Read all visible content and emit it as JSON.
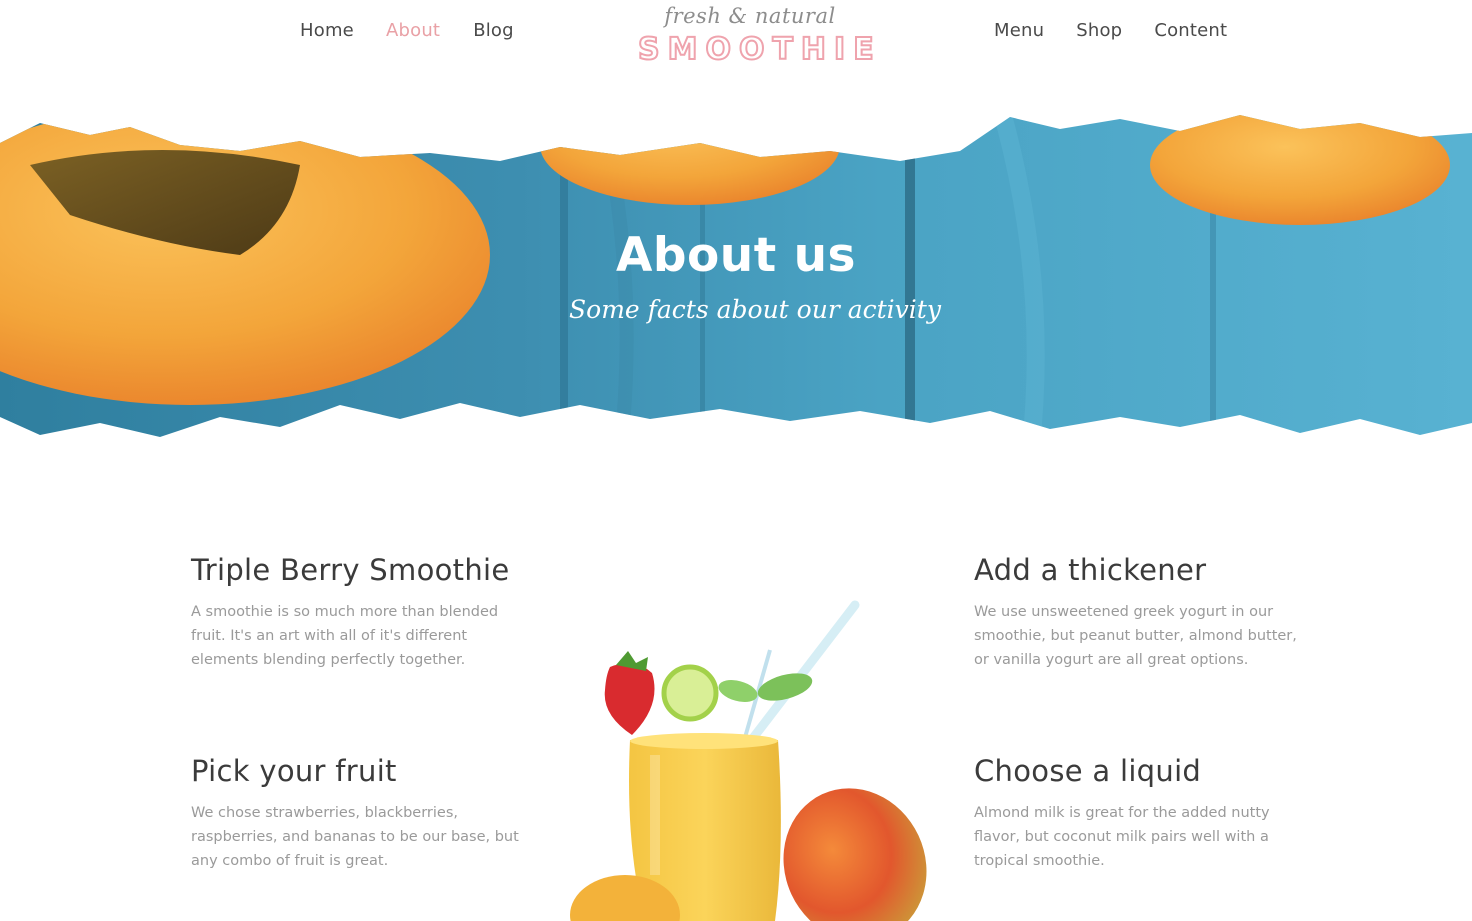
{
  "nav_left": [
    "Home",
    "About",
    "Blog"
  ],
  "nav_right": [
    "Menu",
    "Shop",
    "Content"
  ],
  "active_nav": "About",
  "logo": {
    "tagline": "fresh & natural",
    "brand": "SMOOTHIE"
  },
  "hero": {
    "title": "About us",
    "subtitle": "Some facts about our activity"
  },
  "features": [
    {
      "title": "Triple Berry Smoothie",
      "text": "A smoothie is so much more than blended fruit. It's an art with all of it's different elements blending perfectly together."
    },
    {
      "title": "Add a thickener",
      "text": "We use unsweetened greek yogurt in our smoothie, but peanut butter, almond butter, or vanilla yogurt are all great options."
    },
    {
      "title": "Pick your fruit",
      "text": "We chose strawberries, blackberries, raspberries, and bananas to be our base, but any combo of fruit is great."
    },
    {
      "title": "Choose a liquid",
      "text": "Almond milk is great for the added nutty flavor, but coconut milk pairs well with a tropical smoothie."
    }
  ],
  "colors": {
    "accent_pink": "#e9a1a6",
    "nav_text": "#4a4a4a",
    "body_text": "#9a9a9a",
    "hero_blue": "#4aa3c4",
    "apricot": "#f3a53a"
  }
}
